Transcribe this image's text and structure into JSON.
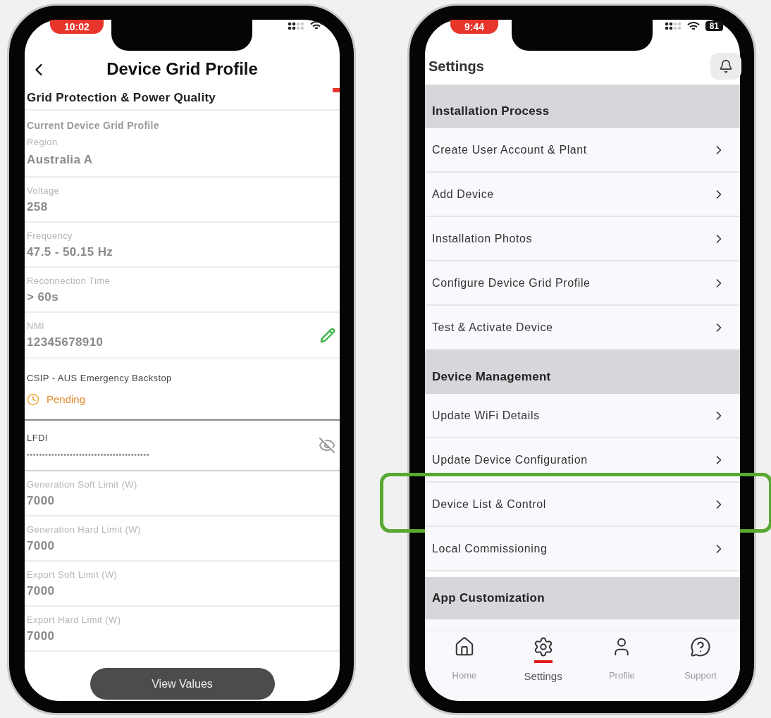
{
  "left_phone": {
    "status_time": "10:02",
    "title": "Device Grid Profile",
    "section_heading": "Grid Protection & Power Quality",
    "profile_title": "Current Device Grid Profile",
    "fields": [
      {
        "kind": "grouped",
        "label": "Region",
        "value": "Australia A"
      },
      {
        "kind": "plain",
        "label": "Voltage",
        "value": "258"
      },
      {
        "kind": "plain",
        "label": "Frequency",
        "value": "47.5 - 50.15 Hz"
      },
      {
        "kind": "plain",
        "label": "Reconnection Time",
        "value": "> 60s"
      },
      {
        "kind": "editable",
        "label": "NMI",
        "value": "12345678910"
      },
      {
        "kind": "status",
        "label": "CSIP - AUS Emergency Backstop",
        "value": "Pending"
      },
      {
        "kind": "masked",
        "label": "LFDI",
        "value": "••••••••••••••••••••••••••••••••••••••••"
      },
      {
        "kind": "plain",
        "label": "Generation Soft Limit (W)",
        "value": "7000"
      },
      {
        "kind": "plain",
        "label": "Generation Hard Limit (W)",
        "value": "7000"
      },
      {
        "kind": "plain",
        "label": "Export Soft Limit (W)",
        "value": "7000"
      },
      {
        "kind": "plain",
        "label": "Export Hard Limit (W)",
        "value": "7000"
      }
    ],
    "button": "View Values"
  },
  "right_phone": {
    "status_time": "9:44",
    "battery": "81",
    "title": "Settings",
    "sections": [
      {
        "heading": "Installation Process",
        "items": [
          {
            "label": "Create User Account & Plant",
            "highlighted": false
          },
          {
            "label": "Add Device",
            "highlighted": false
          },
          {
            "label": "Installation Photos",
            "highlighted": false
          },
          {
            "label": "Configure Device Grid Profile",
            "highlighted": false
          },
          {
            "label": "Test & Activate Device",
            "highlighted": false
          }
        ]
      },
      {
        "heading": "Device Management",
        "items": [
          {
            "label": "Update WiFi Details",
            "highlighted": false
          },
          {
            "label": "Update Device Configuration",
            "highlighted": false
          },
          {
            "label": "Device List & Control",
            "highlighted": true
          },
          {
            "label": "Local Commissioning",
            "highlighted": false
          }
        ]
      },
      {
        "heading": "App Customization"
      }
    ],
    "nav": [
      {
        "kind": "home",
        "label": "Home",
        "selected": false
      },
      {
        "kind": "settings",
        "label": "Settings",
        "selected": true
      },
      {
        "kind": "profile",
        "label": "Profile",
        "selected": false
      },
      {
        "kind": "support",
        "label": "Support",
        "selected": false
      }
    ]
  }
}
